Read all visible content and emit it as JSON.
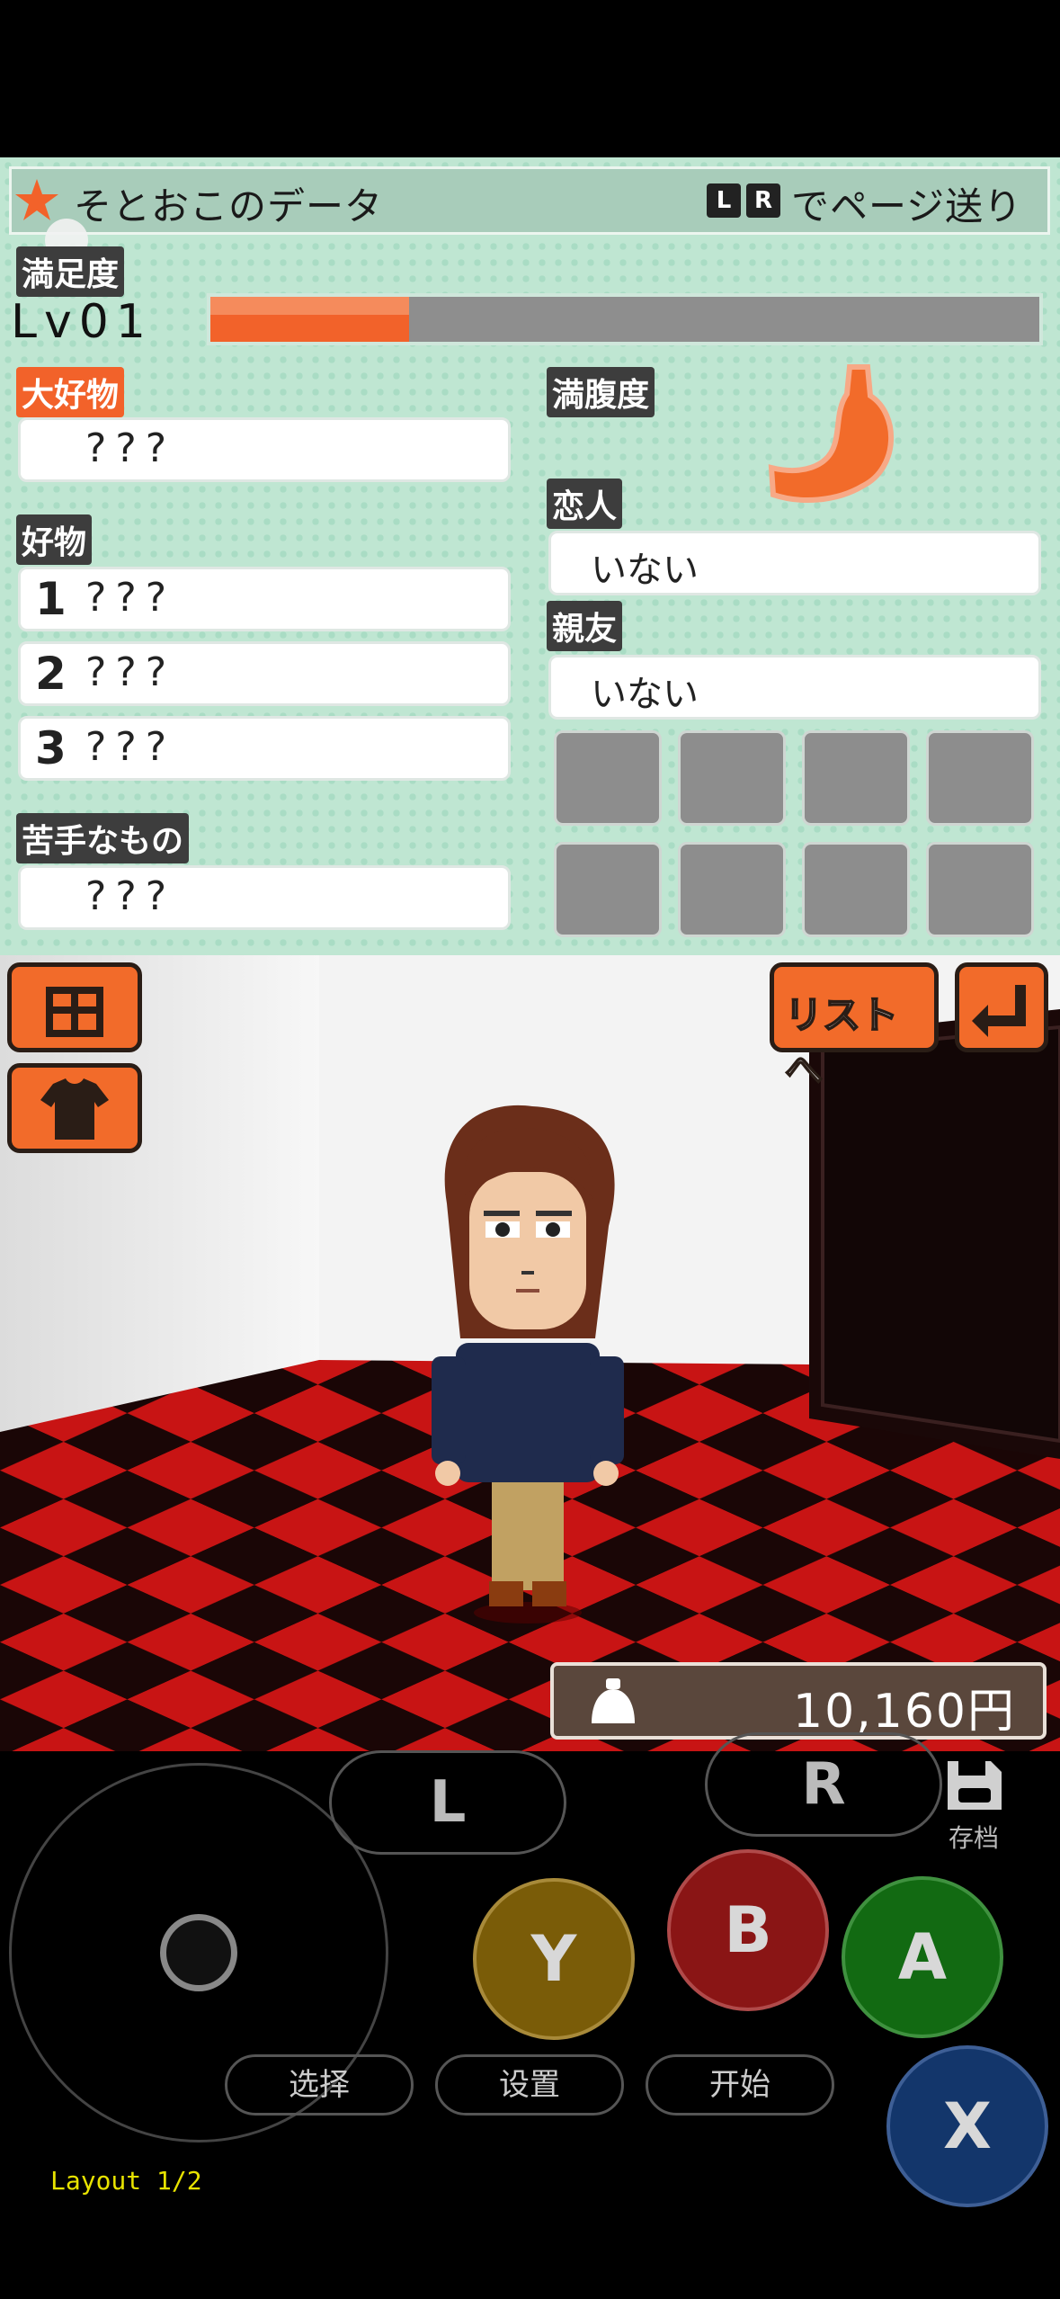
{
  "top": {
    "title": "そとおこのデータ",
    "page_hint": "でページ送り",
    "lr_keys": [
      "L",
      "R"
    ],
    "satisfaction_label": "満足度",
    "level": "Lv01",
    "satisfaction_fill": 0.24,
    "favorite_label": "大好物",
    "favorite_value": "???",
    "fullness_label": "満腹度",
    "likes_label": "好物",
    "likes": [
      {
        "n": "1",
        "v": "???"
      },
      {
        "n": "2",
        "v": "???"
      },
      {
        "n": "3",
        "v": "???"
      }
    ],
    "dislike_label": "苦手なもの",
    "dislike_value": "???",
    "lover_label": "恋人",
    "lover_value": "いない",
    "bestfriend_label": "親友",
    "bestfriend_value": "いない"
  },
  "room": {
    "list_button": "リストへ",
    "money": "10,160円"
  },
  "controls": {
    "l": "L",
    "r": "R",
    "save_label": "存档",
    "y": "Y",
    "b": "B",
    "a": "A",
    "x": "X",
    "select": "选择",
    "settings": "设置",
    "start": "开始",
    "layout": "Layout 1/2"
  },
  "colors": {
    "accent": "#f26b2a",
    "button_y": "#7a5c08",
    "button_b": "#8a1515",
    "button_a": "#126a12",
    "button_x": "#13366b"
  }
}
